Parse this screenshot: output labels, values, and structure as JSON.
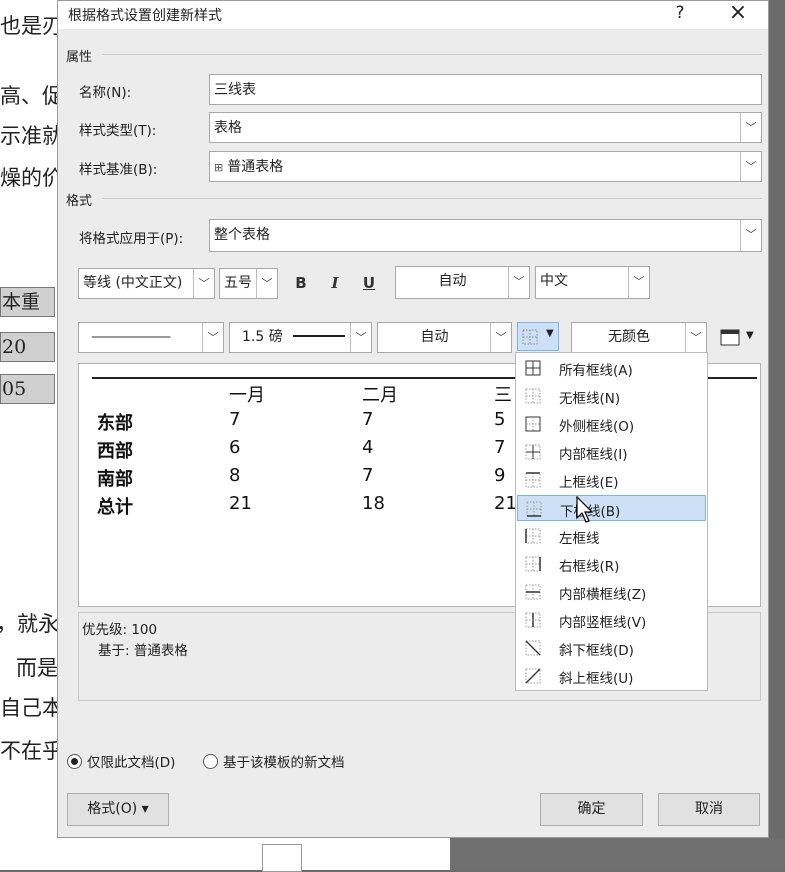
{
  "document": {
    "lines": [
      "也是刃",
      "高、促",
      "示准就",
      "燥的价",
      "，就永",
      "而是",
      "自己本",
      "不在乎"
    ],
    "cells": [
      "本重",
      "20",
      "05"
    ]
  },
  "dialog": {
    "title": "根据格式设置创建新样式",
    "help_label": "?",
    "close_label": "×",
    "properties": {
      "section": "属性",
      "name_label": "名称(N):",
      "name_value": "三线表",
      "type_label": "样式类型(T):",
      "type_value": "表格",
      "base_label": "样式基准(B):",
      "base_value": "普通表格"
    },
    "format": {
      "section": "格式",
      "apply_label": "将格式应用于(P):",
      "apply_value": "整个表格",
      "font": "等线 (中文正文)",
      "size": "五号",
      "bold": "B",
      "italic": "I",
      "underline": "U",
      "color": "自动",
      "script": "中文",
      "line_style": "———————",
      "line_weight": "1.5 磅",
      "border_color": "自动",
      "shading": "无颜色"
    },
    "preview": {
      "headers": [
        "一月",
        "二月",
        "三"
      ],
      "rows": [
        {
          "label": "东部",
          "values": [
            "7",
            "7",
            "5"
          ]
        },
        {
          "label": "西部",
          "values": [
            "6",
            "4",
            "7"
          ]
        },
        {
          "label": "南部",
          "values": [
            "8",
            "7",
            "9"
          ]
        },
        {
          "label": "总计",
          "values": [
            "21",
            "18",
            "21"
          ]
        }
      ]
    },
    "description": {
      "priority": "优先级: 100",
      "based_on": "基于: 普通表格"
    },
    "radio_this_doc": "仅限此文档(D)",
    "radio_template": "基于该模板的新文档",
    "format_button": "格式(O) ▾",
    "ok_button": "确定",
    "cancel_button": "取消"
  },
  "border_menu": {
    "items": [
      {
        "label": "所有框线(A)",
        "icon": "all-borders-icon"
      },
      {
        "label": "无框线(N)",
        "icon": "no-border-icon"
      },
      {
        "label": "外侧框线(O)",
        "icon": "outside-borders-icon"
      },
      {
        "label": "内部框线(I)",
        "icon": "inside-borders-icon"
      },
      {
        "label": "上框线(E)",
        "icon": "top-border-icon"
      },
      {
        "label": "下框线(B)",
        "icon": "bottom-border-icon"
      },
      {
        "label": "左框线",
        "icon": "left-border-icon"
      },
      {
        "label": "右框线(R)",
        "icon": "right-border-icon"
      },
      {
        "label": "内部横框线(Z)",
        "icon": "inside-horizontal-border-icon"
      },
      {
        "label": "内部竖框线(V)",
        "icon": "inside-vertical-border-icon"
      },
      {
        "label": "斜下框线(D)",
        "icon": "diagonal-down-border-icon"
      },
      {
        "label": "斜上框线(U)",
        "icon": "diagonal-up-border-icon"
      }
    ],
    "selected_index": 5
  }
}
